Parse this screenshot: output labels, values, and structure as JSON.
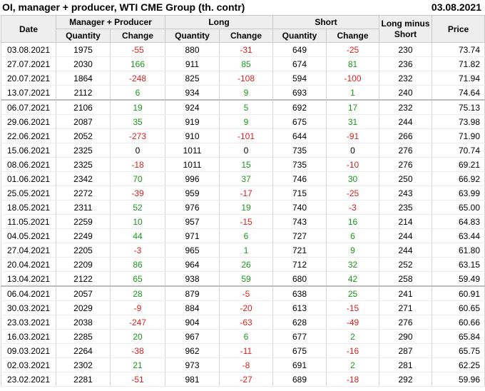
{
  "header": {
    "title": "OI, manager + producer, WTI CME Group (th. contr)",
    "date": "03.08.2021"
  },
  "columns": {
    "date": "Date",
    "manager_producer": "Manager + Producer",
    "long": "Long",
    "short": "Short",
    "long_minus_short": "Long minus Short",
    "price": "Price",
    "quantity": "Quantity",
    "change": "Change"
  },
  "colors": {
    "positive": "#1a9a1a",
    "negative": "#e0201e",
    "header_bg": "#eeeeee"
  },
  "rows": [
    {
      "date": "03.08.2021",
      "mp_q": "1975",
      "mp_c": "-55",
      "l_q": "880",
      "l_c": "-31",
      "s_q": "649",
      "s_c": "-25",
      "lms": "230",
      "price": "73.74"
    },
    {
      "date": "27.07.2021",
      "mp_q": "2030",
      "mp_c": "166",
      "l_q": "911",
      "l_c": "85",
      "s_q": "674",
      "s_c": "81",
      "lms": "236",
      "price": "71.82"
    },
    {
      "date": "20.07.2021",
      "mp_q": "1864",
      "mp_c": "-248",
      "l_q": "825",
      "l_c": "-108",
      "s_q": "594",
      "s_c": "-100",
      "lms": "232",
      "price": "71.94"
    },
    {
      "date": "13.07.2021",
      "mp_q": "2112",
      "mp_c": "6",
      "l_q": "934",
      "l_c": "9",
      "s_q": "693",
      "s_c": "1",
      "lms": "240",
      "price": "74.64"
    },
    {
      "date": "06.07.2021",
      "mp_q": "2106",
      "mp_c": "19",
      "l_q": "924",
      "l_c": "5",
      "s_q": "692",
      "s_c": "17",
      "lms": "232",
      "price": "75.13"
    },
    {
      "date": "29.06.2021",
      "mp_q": "2087",
      "mp_c": "35",
      "l_q": "919",
      "l_c": "9",
      "s_q": "675",
      "s_c": "31",
      "lms": "244",
      "price": "73.98"
    },
    {
      "date": "22.06.2021",
      "mp_q": "2052",
      "mp_c": "-273",
      "l_q": "910",
      "l_c": "-101",
      "s_q": "644",
      "s_c": "-91",
      "lms": "266",
      "price": "71.90"
    },
    {
      "date": "15.06.2021",
      "mp_q": "2325",
      "mp_c": "0",
      "l_q": "1011",
      "l_c": "0",
      "s_q": "735",
      "s_c": "0",
      "lms": "276",
      "price": "70.74"
    },
    {
      "date": "08.06.2021",
      "mp_q": "2325",
      "mp_c": "-18",
      "l_q": "1011",
      "l_c": "15",
      "s_q": "735",
      "s_c": "-10",
      "lms": "276",
      "price": "69.21"
    },
    {
      "date": "01.06.2021",
      "mp_q": "2342",
      "mp_c": "70",
      "l_q": "996",
      "l_c": "37",
      "s_q": "746",
      "s_c": "30",
      "lms": "250",
      "price": "66.92"
    },
    {
      "date": "25.05.2021",
      "mp_q": "2272",
      "mp_c": "-39",
      "l_q": "959",
      "l_c": "-17",
      "s_q": "715",
      "s_c": "-25",
      "lms": "243",
      "price": "63.99"
    },
    {
      "date": "18.05.2021",
      "mp_q": "2311",
      "mp_c": "52",
      "l_q": "976",
      "l_c": "19",
      "s_q": "740",
      "s_c": "-3",
      "lms": "235",
      "price": "65.00"
    },
    {
      "date": "11.05.2021",
      "mp_q": "2259",
      "mp_c": "10",
      "l_q": "957",
      "l_c": "-15",
      "s_q": "743",
      "s_c": "16",
      "lms": "214",
      "price": "64.83"
    },
    {
      "date": "04.05.2021",
      "mp_q": "2249",
      "mp_c": "44",
      "l_q": "971",
      "l_c": "6",
      "s_q": "727",
      "s_c": "6",
      "lms": "244",
      "price": "63.44"
    },
    {
      "date": "27.04.2021",
      "mp_q": "2205",
      "mp_c": "-3",
      "l_q": "965",
      "l_c": "1",
      "s_q": "721",
      "s_c": "9",
      "lms": "244",
      "price": "61.80"
    },
    {
      "date": "20.04.2021",
      "mp_q": "2209",
      "mp_c": "86",
      "l_q": "964",
      "l_c": "26",
      "s_q": "712",
      "s_c": "32",
      "lms": "252",
      "price": "63.15"
    },
    {
      "date": "13.04.2021",
      "mp_q": "2122",
      "mp_c": "65",
      "l_q": "938",
      "l_c": "59",
      "s_q": "680",
      "s_c": "42",
      "lms": "258",
      "price": "59.49"
    },
    {
      "date": "06.04.2021",
      "mp_q": "2057",
      "mp_c": "28",
      "l_q": "879",
      "l_c": "-5",
      "s_q": "638",
      "s_c": "25",
      "lms": "241",
      "price": "60.91"
    },
    {
      "date": "30.03.2021",
      "mp_q": "2029",
      "mp_c": "-9",
      "l_q": "884",
      "l_c": "-20",
      "s_q": "613",
      "s_c": "-15",
      "lms": "271",
      "price": "60.65"
    },
    {
      "date": "23.03.2021",
      "mp_q": "2038",
      "mp_c": "-247",
      "l_q": "904",
      "l_c": "-63",
      "s_q": "628",
      "s_c": "-49",
      "lms": "276",
      "price": "60.66"
    },
    {
      "date": "16.03.2021",
      "mp_q": "2285",
      "mp_c": "20",
      "l_q": "967",
      "l_c": "6",
      "s_q": "677",
      "s_c": "2",
      "lms": "290",
      "price": "65.84"
    },
    {
      "date": "09.03.2021",
      "mp_q": "2264",
      "mp_c": "-38",
      "l_q": "962",
      "l_c": "-11",
      "s_q": "675",
      "s_c": "-16",
      "lms": "287",
      "price": "65.75"
    },
    {
      "date": "02.03.2021",
      "mp_q": "2302",
      "mp_c": "21",
      "l_q": "973",
      "l_c": "-8",
      "s_q": "691",
      "s_c": "2",
      "lms": "281",
      "price": "62.25"
    },
    {
      "date": "23.02.2021",
      "mp_q": "2281",
      "mp_c": "-51",
      "l_q": "981",
      "l_c": "-27",
      "s_q": "689",
      "s_c": "-18",
      "lms": "292",
      "price": "59.96"
    }
  ]
}
